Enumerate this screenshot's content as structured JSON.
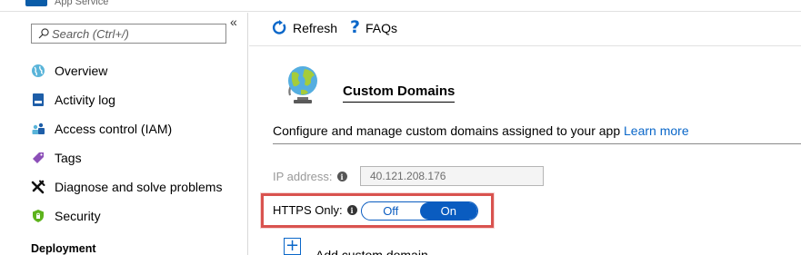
{
  "header": {
    "subtitle": "App Service"
  },
  "sidebar": {
    "search_placeholder": "Search (Ctrl+/)",
    "collapse_glyph": "«",
    "items": [
      {
        "label": "Overview",
        "icon": "globe-icon"
      },
      {
        "label": "Activity log",
        "icon": "activity-log-icon"
      },
      {
        "label": "Access control (IAM)",
        "icon": "iam-users-icon"
      },
      {
        "label": "Tags",
        "icon": "tag-icon"
      },
      {
        "label": "Diagnose and solve problems",
        "icon": "wrench-icon"
      },
      {
        "label": "Security",
        "icon": "shield-icon"
      }
    ],
    "section_header": "Deployment"
  },
  "toolbar": {
    "refresh_label": "Refresh",
    "faqs_label": "FAQs"
  },
  "main": {
    "title": "Custom Domains",
    "description": "Configure and manage custom domains assigned to your app ",
    "learn_more": "Learn more",
    "ip_label": "IP address:",
    "ip_value": "40.121.208.176",
    "https_label": "HTTPS Only:",
    "toggle_off": "Off",
    "toggle_on": "On",
    "toggle_selected": "On",
    "add_label": "Add custom domain"
  },
  "colors": {
    "accent": "#0a5cc0",
    "link": "#0a67c9",
    "highlight": "#d9534f"
  }
}
